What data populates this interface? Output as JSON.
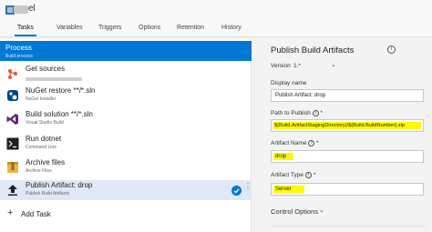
{
  "header": {
    "title": "el"
  },
  "tabs": [
    {
      "label": "Tasks",
      "active": true
    },
    {
      "label": "Variables",
      "active": false
    },
    {
      "label": "Triggers",
      "active": false
    },
    {
      "label": "Options",
      "active": false
    },
    {
      "label": "Retention",
      "active": false
    },
    {
      "label": "History",
      "active": false
    }
  ],
  "process": {
    "title": "Process",
    "subtitle": "Build process"
  },
  "tasks": [
    {
      "name": "Get sources",
      "subtitle": "",
      "icon": "git-icon",
      "selected": false
    },
    {
      "name": "NuGet restore **/*.sln",
      "subtitle": "NuGet Installer",
      "icon": "nuget-icon",
      "selected": false
    },
    {
      "name": "Build solution **/*.sln",
      "subtitle": "Visual Studio Build",
      "icon": "visual-studio-icon",
      "selected": false
    },
    {
      "name": "Run dotnet",
      "subtitle": "Command Line",
      "icon": "command-line-icon",
      "selected": false
    },
    {
      "name": "Archive files",
      "subtitle": "Archive Files",
      "icon": "archive-icon",
      "selected": false
    },
    {
      "name": "Publish Artifact: drop",
      "subtitle": "Publish Build Artifacts",
      "icon": "upload-icon",
      "selected": true
    }
  ],
  "add_task": "Add Task",
  "detail": {
    "title": "Publish Build Artifacts",
    "version_label": "Version",
    "version_value": "1.*",
    "display_name_label": "Display name",
    "display_name_value": "Publish Artifact: drop",
    "path_label": "Path to Publish",
    "path_value": "$(Build.ArtifactStagingDirectory)/$(Build.BuildNumber).zip",
    "artifact_name_label": "Artifact Name",
    "artifact_name_value": "drop",
    "artifact_type_label": "Artifact Type",
    "artifact_type_value": "Server",
    "control_options": "Control Options"
  },
  "colors": {
    "accent": "#0078d4",
    "highlight": "#fffa00",
    "selected_row": "#dfe9f5"
  }
}
